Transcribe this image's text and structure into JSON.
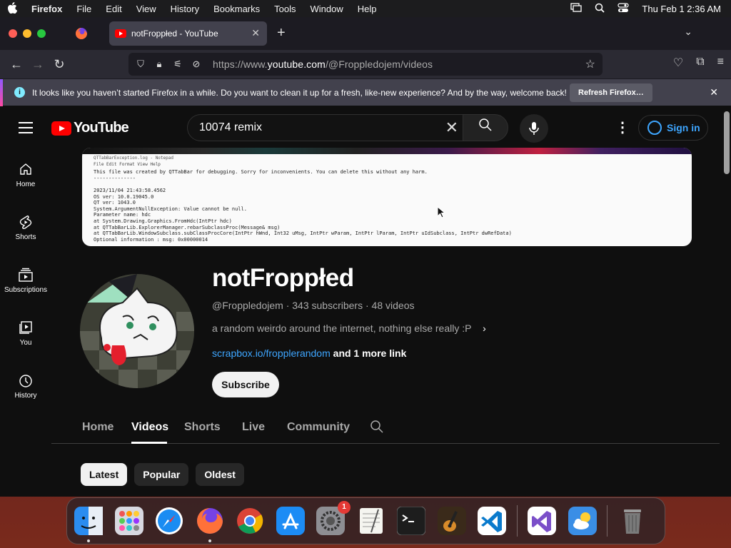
{
  "menubar": {
    "app": "Firefox",
    "items": [
      "File",
      "Edit",
      "View",
      "History",
      "Bookmarks",
      "Tools",
      "Window",
      "Help"
    ],
    "datetime": "Thu Feb 1  2:36 AM"
  },
  "browser": {
    "tab_title": "notFroppłed - YouTube",
    "url_prefix": "https://www.",
    "url_domain": "youtube.com",
    "url_path": "/@Froppledojem/videos"
  },
  "notification": {
    "message": "It looks like you haven’t started Firefox in a while. Do you want to clean it up for a fresh, like-new experience? And by the way, welcome back!",
    "button": "Refresh Firefox…"
  },
  "youtube": {
    "logo_text": "YouTube",
    "search_value": "10074 remix",
    "signin": "Sign in",
    "sidebar": [
      {
        "label": "Home",
        "icon": "home-icon"
      },
      {
        "label": "Shorts",
        "icon": "shorts-icon"
      },
      {
        "label": "Subscriptions",
        "icon": "subscriptions-icon"
      },
      {
        "label": "You",
        "icon": "you-icon"
      },
      {
        "label": "History",
        "icon": "history-icon"
      }
    ],
    "banner": {
      "title": "QTTabBarException.log - Notepad",
      "menu": "File   Edit   Format   View   Help",
      "lines": [
        "This file was created by QTTabBar for debugging. Sorry for inconvenients. You can delete this without any harm.",
        "--------------",
        "",
        "2023/11/04 21:43:58.4562",
        "OS ver: 10.0.19045.0",
        "QT ver: 1043.0",
        "System.ArgumentNullException: Value cannot be null.",
        "Parameter name: hdc",
        "   at System.Drawing.Graphics.FromHdc(IntPtr hdc)",
        "   at QTTabBarLib.ExplorerManager.rebarSubclassProc(Message& msg)",
        "   at QTTabBarLib.WindowSubclass.subClassProcCore(IntPtr hWnd, Int32 uMsg, IntPtr wParam, IntPtr lParam, IntPtr uIdSubclass, IntPtr dwRefData)",
        "Optional information : msg: 0x00000014"
      ]
    },
    "channel": {
      "name": "notFroppłed",
      "handle": "@Froppledojem",
      "subscribers": "343 subscribers",
      "videos": "48 videos",
      "description": "a random weirdo around the internet, nothing else really :P",
      "link": "scrapbox.io/fropplerandom",
      "more_links": "and 1 more link",
      "subscribe": "Subscribe"
    },
    "tabs": [
      "Home",
      "Videos",
      "Shorts",
      "Live",
      "Community"
    ],
    "active_tab": "Videos",
    "chips": [
      "Latest",
      "Popular",
      "Oldest"
    ],
    "selected_chip": "Latest"
  },
  "dock": [
    {
      "name": "finder-icon",
      "color": "#2b8cf0"
    },
    {
      "name": "launchpad-icon",
      "color": "#c9c9d2"
    },
    {
      "name": "safari-icon",
      "color": "#1a8cf2"
    },
    {
      "name": "firefox-icon",
      "color": "#ff7139"
    },
    {
      "name": "chrome-icon",
      "color": "#ffffff"
    },
    {
      "name": "app-store-icon",
      "color": "#1c8cf5"
    },
    {
      "name": "system-settings-icon",
      "color": "#8e8e93",
      "badge": "1"
    },
    {
      "name": "textedit-icon",
      "color": "#f5f5f0"
    },
    {
      "name": "terminal-icon",
      "color": "#1d1d1d"
    },
    {
      "name": "garageband-icon",
      "color": "#3a2a1a"
    },
    {
      "name": "vscode-icon",
      "color": "#ffffff"
    },
    {
      "name": "visual-studio-icon",
      "color": "#ffffff"
    },
    {
      "name": "weather-icon",
      "color": "#3a8ee6"
    },
    {
      "name": "trash-icon",
      "color": "#6a6a6a"
    }
  ]
}
